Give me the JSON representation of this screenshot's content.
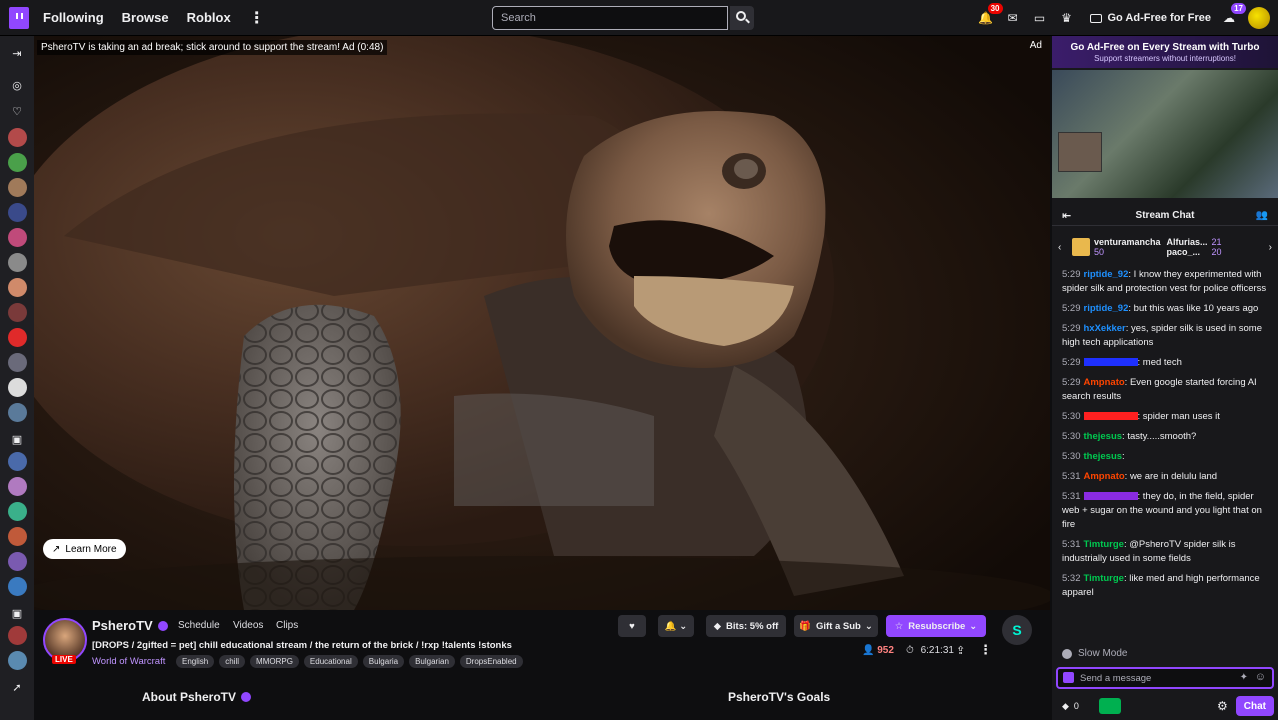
{
  "topbar": {
    "nav": [
      "Following",
      "Browse",
      "Roblox"
    ],
    "search_placeholder": "Search",
    "notifications_count": "30",
    "prime_count": "17",
    "adfree_label": "Go Ad-Free for Free"
  },
  "player": {
    "ad_message": "PsheroTV is taking an ad break; stick around to support the stream! Ad (0:48)",
    "ad_tag": "Ad",
    "learn_more": "Learn More"
  },
  "channel": {
    "name": "PsheroTV",
    "tabs": [
      "Schedule",
      "Videos",
      "Clips"
    ],
    "live_label": "LIVE",
    "title": "[DROPS / 2gifted = pet] chill educational stream / the return of the brick / !rxp !talents !stonks",
    "game": "World of Warcraft",
    "tags": [
      "English",
      "chill",
      "MMORPG",
      "Educational",
      "Bulgaria",
      "Bulgarian",
      "DropsEnabled"
    ],
    "bits_label": "Bits: 5% off",
    "gift_label": "Gift a Sub",
    "resub_label": "Resubscribe",
    "viewers": "952",
    "uptime": "6:21:31",
    "about_title": "About PsheroTV",
    "goals_title": "PsheroTV's Goals"
  },
  "chat": {
    "turbo_title": "Go Ad-Free on Every Stream with Turbo",
    "turbo_sub": "Support streamers without interruptions!",
    "header": "Stream Chat",
    "gift_user": "venturamancha",
    "gift_count": "50",
    "gift_user2": "Alfurias...",
    "gift_count2": "21",
    "gift_user3": "paco_...",
    "gift_count3": "20",
    "messages": [
      {
        "time": "5:29",
        "user": "riptide_92",
        "color": "#1e90ff",
        "text": ": I know they experimented with spider silk and protection vest for police officerss"
      },
      {
        "time": "5:29",
        "user": "riptide_92",
        "color": "#1e90ff",
        "text": ": but this was like 10 years ago"
      },
      {
        "time": "5:29",
        "user": "hxXekker",
        "color": "#1e90ff",
        "text": ": yes, spider silk is used in some high tech applications"
      },
      {
        "time": "5:29",
        "user": "",
        "color": "#1e30ff",
        "text": ": med tech"
      },
      {
        "time": "5:29",
        "user": "Ampnato",
        "color": "#ff4500",
        "text": ": Even google started forcing AI search results"
      },
      {
        "time": "5:30",
        "user": "",
        "color": "#ff2020",
        "text": ": spider man uses it"
      },
      {
        "time": "5:30",
        "user": "thejesus",
        "color": "#00c850",
        "text": ": tasty.....smooth?"
      },
      {
        "time": "5:30",
        "user": "thejesus",
        "color": "#00c850",
        "text": ":"
      },
      {
        "time": "5:31",
        "user": "Ampnato",
        "color": "#ff4500",
        "text": ": we are in delulu land"
      },
      {
        "time": "5:31",
        "user": "",
        "color": "#8a2be2",
        "text": ": they do, in the field, spider web + sugar on the wound and you light that on fire"
      },
      {
        "time": "5:31",
        "user": "Timturge",
        "color": "#00c850",
        "text": ": @PsheroTV spider silk is industrially used in some fields"
      },
      {
        "time": "5:32",
        "user": "Timturge",
        "color": "#00c850",
        "text": ": like med and high performance apparel"
      }
    ],
    "slow_mode": "Slow Mode",
    "input_placeholder": "Send a message",
    "points": "0",
    "chat_button": "Chat"
  }
}
